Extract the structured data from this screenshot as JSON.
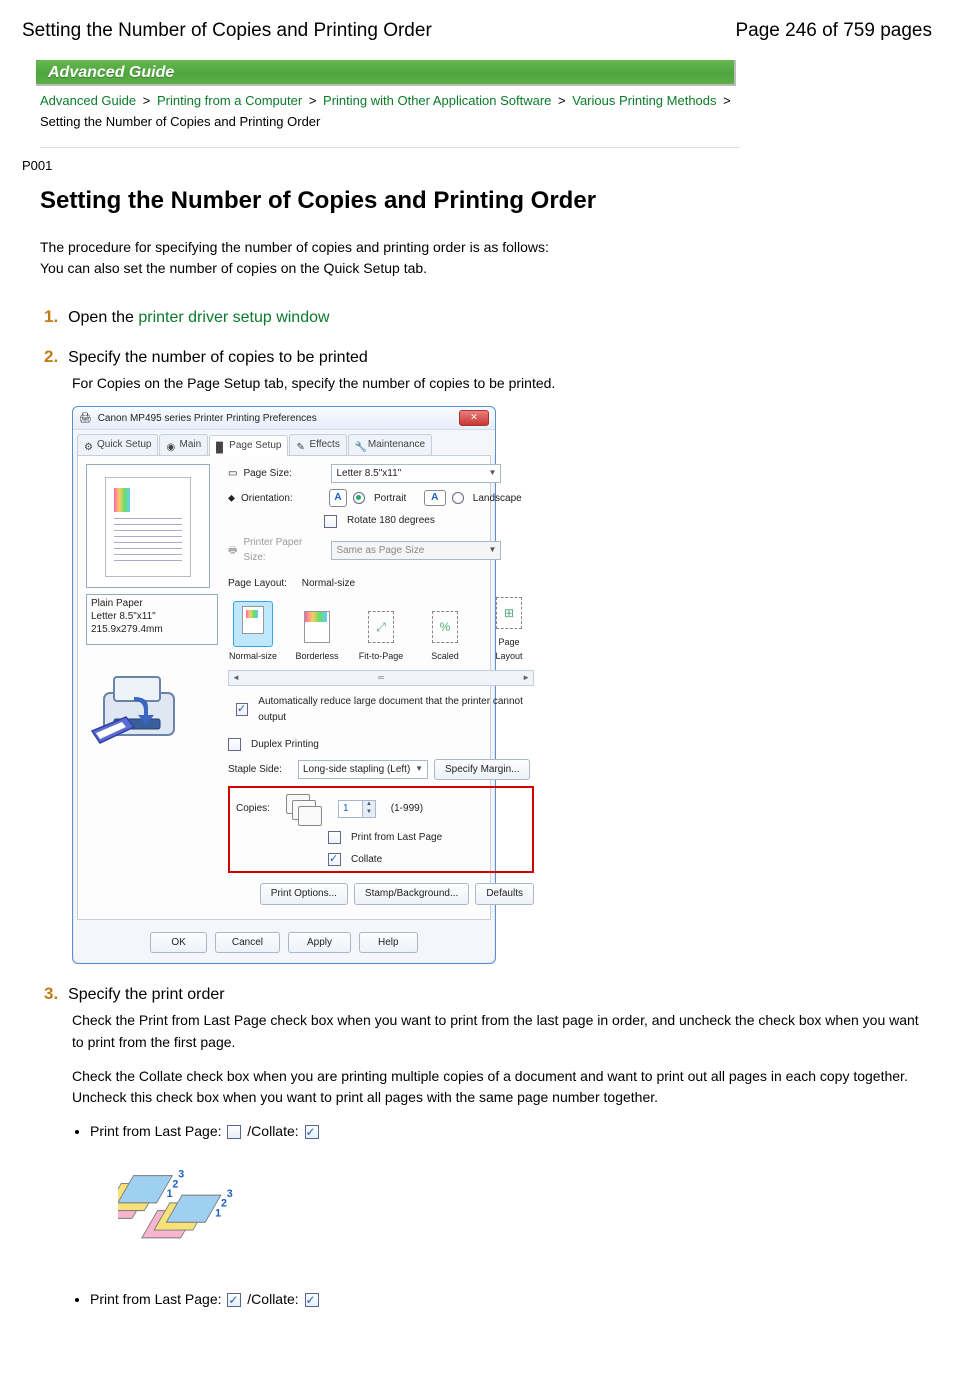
{
  "header": {
    "left": "Setting the Number of Copies and Printing Order",
    "right": "Page 246 of 759 pages"
  },
  "banner": "Advanced Guide",
  "breadcrumbs": {
    "links": [
      "Advanced Guide",
      "Printing from a Computer",
      "Printing with Other Application Software",
      "Various Printing Methods"
    ],
    "current": "Setting the Number of Copies and Printing Order",
    "sep": ">"
  },
  "page_code": "P001",
  "title": "Setting the Number of Copies and Printing Order",
  "intro": {
    "l1": "The procedure for specifying the number of copies and printing order is as follows:",
    "l2": "You can also set the number of copies on the Quick Setup tab."
  },
  "steps": {
    "s1": {
      "num": "1.",
      "prefix": "Open the ",
      "link": "printer driver setup window"
    },
    "s2": {
      "num": "2.",
      "title": "Specify the number of copies to be printed",
      "desc": "For Copies on the Page Setup tab, specify the number of copies to be printed."
    },
    "s3": {
      "num": "3.",
      "title": "Specify the print order",
      "p1": "Check the Print from Last Page check box when you want to print from the last page in order, and uncheck the check box when you want to print from the first page.",
      "p2": "Check the Collate check box when you are printing multiple copies of a document and want to print out all pages in each copy together. Uncheck this check box when you want to print all pages with the same page number together.",
      "b1a": "Print from Last Page: ",
      "b1b": " /Collate: ",
      "b2a": "Print from Last Page: ",
      "b2b": " /Collate: "
    }
  },
  "dialog": {
    "title": "Canon MP495 series Printer Printing Preferences",
    "tabs": [
      "Quick Setup",
      "Main",
      "Page Setup",
      "Effects",
      "Maintenance"
    ],
    "active_tab": 2,
    "preview_caption": {
      "l1": "Plain Paper",
      "l2": "Letter 8.5\"x11\" 215.9x279.4mm"
    },
    "page_size": {
      "label": "Page Size:",
      "value": "Letter 8.5\"x11\""
    },
    "orientation": {
      "label": "Orientation:",
      "portrait": "Portrait",
      "landscape": "Landscape",
      "rotate": "Rotate 180 degrees"
    },
    "printer_paper": {
      "label": "Printer Paper Size:",
      "value": "Same as Page Size"
    },
    "page_layout": {
      "label": "Page Layout:",
      "value": "Normal-size"
    },
    "layouts": [
      "Normal-size",
      "Borderless",
      "Fit-to-Page",
      "Scaled",
      "Page Layout"
    ],
    "auto_reduce": "Automatically reduce large document that the printer cannot output",
    "duplex": "Duplex Printing",
    "staple": {
      "label": "Staple Side:",
      "value": "Long-side stapling (Left)",
      "margin_btn": "Specify Margin..."
    },
    "copies": {
      "label": "Copies:",
      "value": "1",
      "range": "(1-999)",
      "print_last": "Print from Last Page",
      "collate": "Collate"
    },
    "bottom_buttons": [
      "Print Options...",
      "Stamp/Background...",
      "Defaults"
    ],
    "footer_buttons": [
      "OK",
      "Cancel",
      "Apply",
      "Help"
    ]
  }
}
